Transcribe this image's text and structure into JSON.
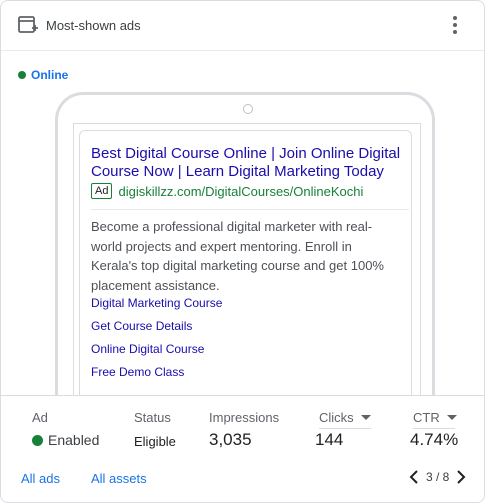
{
  "header": {
    "title": "Most-shown ads",
    "icon": "ad-card-icon",
    "menu_icon": "more-vert-icon"
  },
  "ad_status": "Online",
  "ad": {
    "headline": "Best Digital Course Online | Join Online Digital Course Now | Learn Digital Marketing Today",
    "badge": "Ad",
    "display_url": "digiskillzz.com/DigitalCourses/OnlineKochi",
    "description": "Become a professional digital marketer with real-world projects and expert mentoring. Enroll in Kerala's top digital marketing course and get 100% placement assistance.",
    "sitelinks": [
      "Digital Marketing Course",
      "Get Course Details",
      "Online Digital Course",
      "Free Demo Class"
    ]
  },
  "stats": {
    "headers": {
      "ad": "Ad",
      "status": "Status",
      "impressions": "Impressions",
      "clicks": "Clicks",
      "ctr": "CTR"
    },
    "values": {
      "ad": "Enabled",
      "status": "Eligible",
      "impressions": "3,035",
      "clicks": "144",
      "ctr": "4.74%"
    }
  },
  "footer": {
    "all_ads": "All ads",
    "all_assets": "All assets",
    "pagination": "3 / 8"
  },
  "colors": {
    "link_blue": "#1a73e8",
    "ad_title": "#1a0dab",
    "green": "#188038"
  }
}
